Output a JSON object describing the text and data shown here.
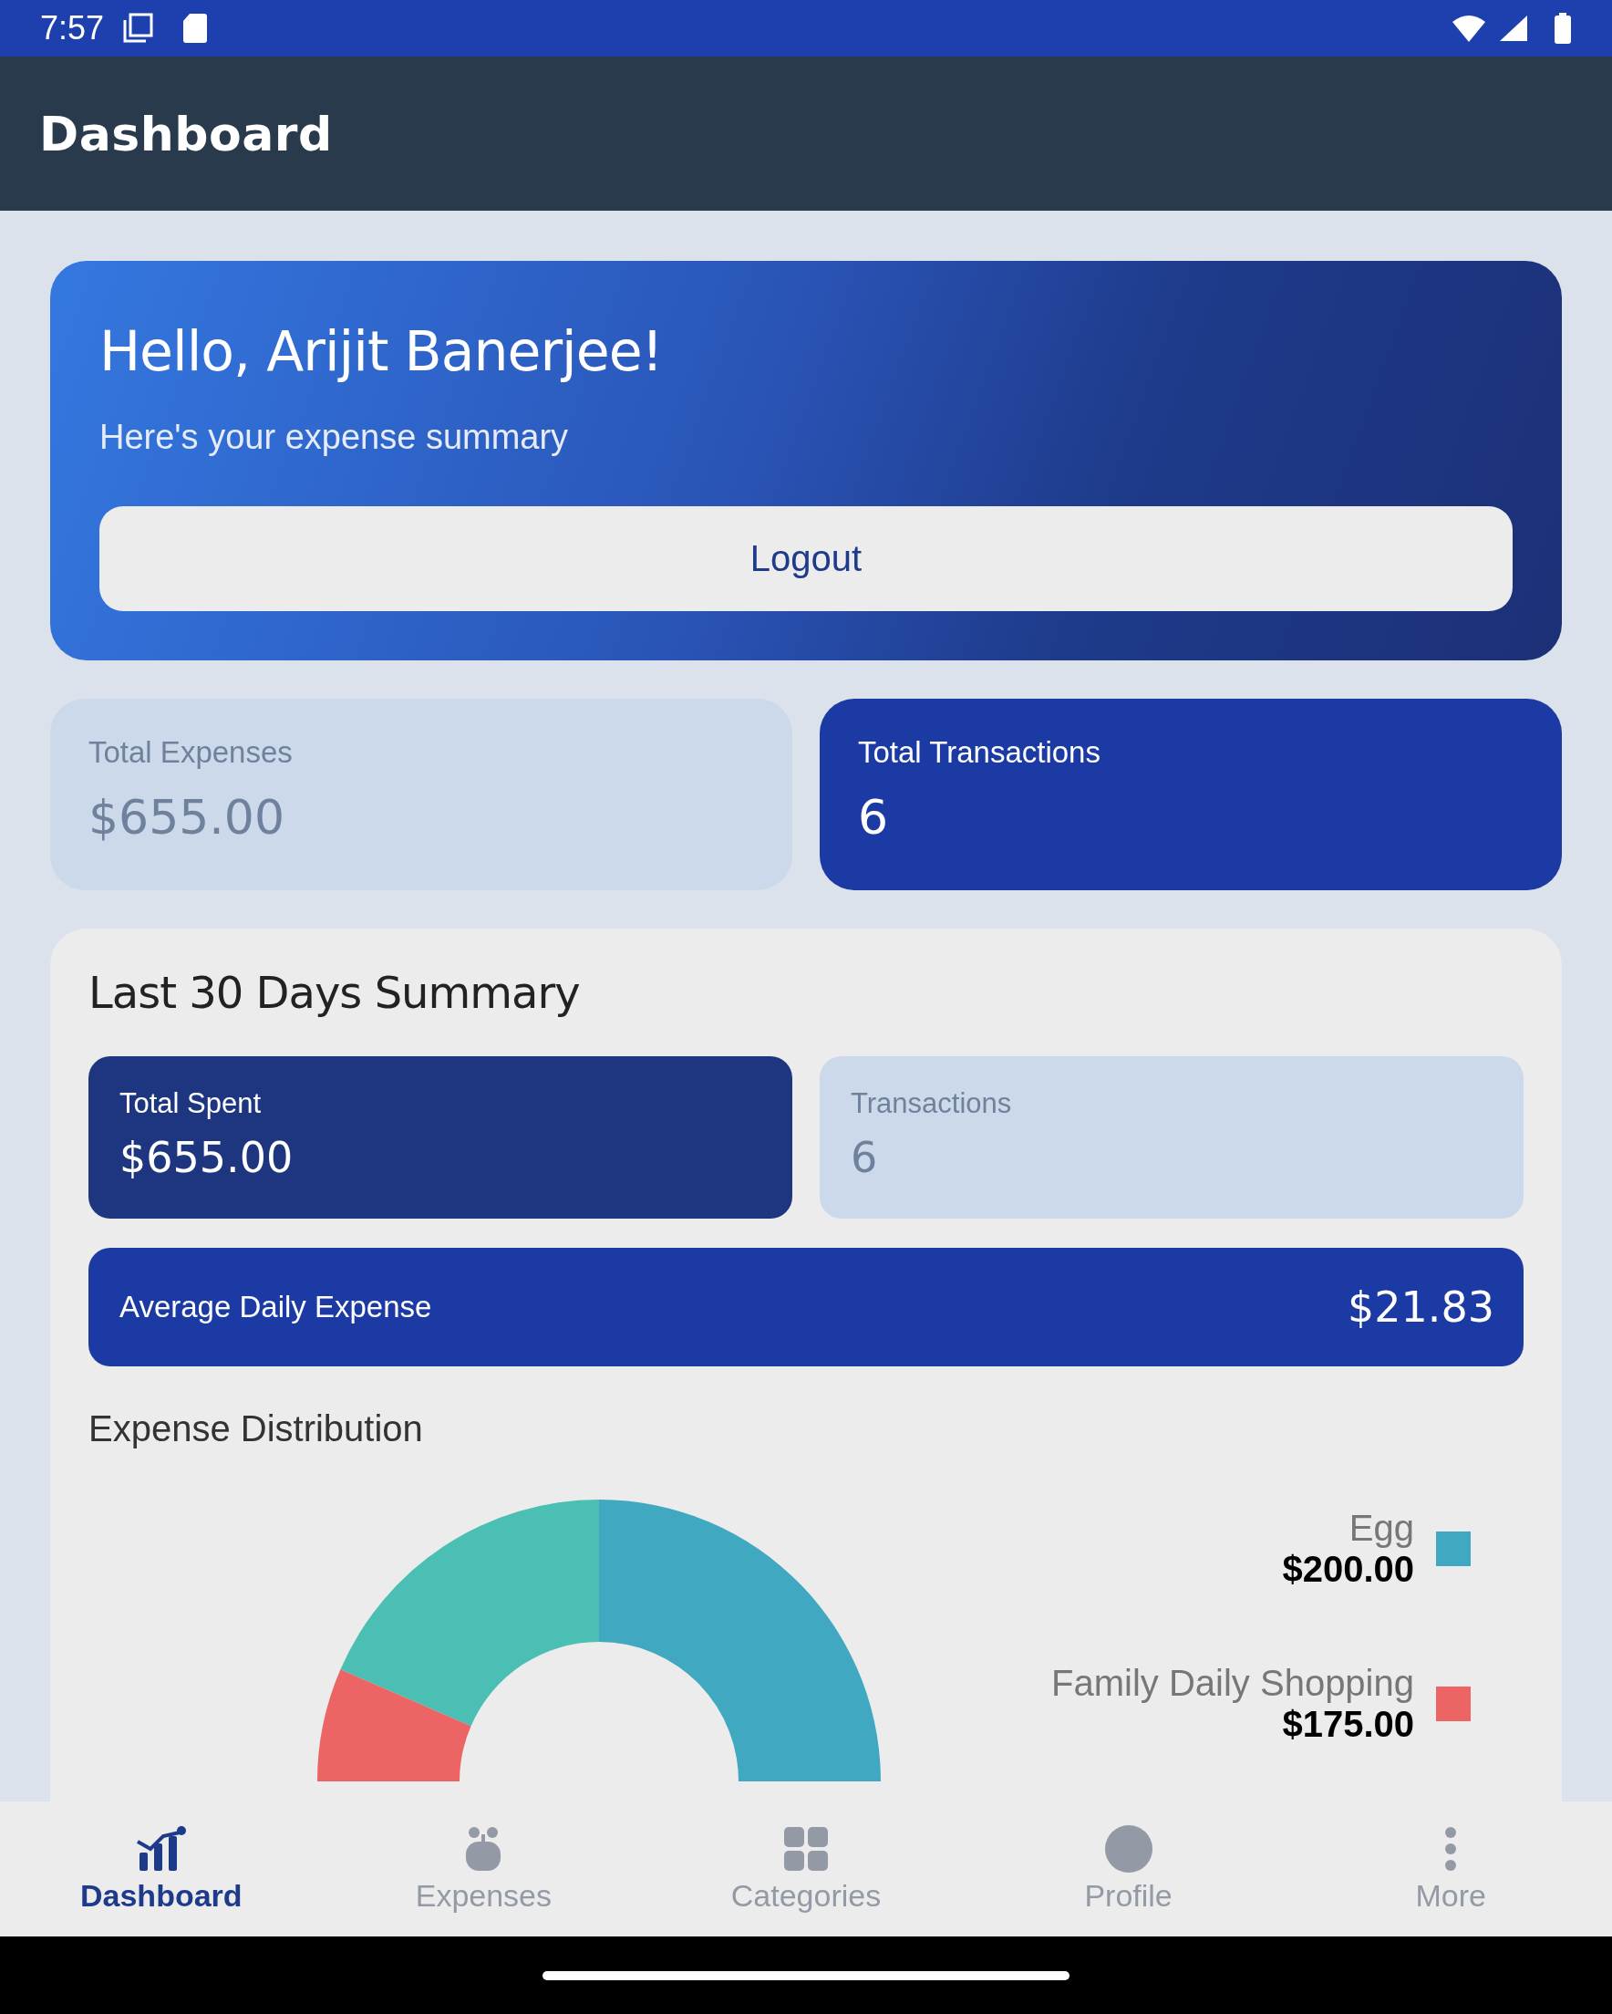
{
  "status_bar": {
    "time": "7:57"
  },
  "app_bar": {
    "title": "Dashboard"
  },
  "hero": {
    "greeting": "Hello, Arijit Banerjee!",
    "subtitle": "Here's your expense summary",
    "button": "Logout"
  },
  "stats": [
    {
      "label": "Total Expenses",
      "value": "$655.00",
      "kind": "muted"
    },
    {
      "label": "Total Transactions",
      "value": "6",
      "kind": "primary"
    }
  ],
  "summary": {
    "title": "Last 30 Days Summary",
    "cards": [
      {
        "label": "Total Spent",
        "value": "$655.00",
        "kind": "dark"
      },
      {
        "label": "Transactions",
        "value": "6",
        "kind": "muted"
      }
    ],
    "average": {
      "label": "Average Daily Expense",
      "value": "$21.83"
    },
    "distribution": {
      "title": "Expense Distribution",
      "legend": [
        {
          "label": "Egg",
          "amount": "$200.00",
          "color": "#41a8c2"
        },
        {
          "label": "Family Daily Shopping",
          "amount": "$175.00",
          "color": "#ec6464"
        }
      ]
    }
  },
  "nav": [
    {
      "label": "Dashboard",
      "selected": true
    },
    {
      "label": "Expenses",
      "selected": false
    },
    {
      "label": "Categories",
      "selected": false
    },
    {
      "label": "Profile",
      "selected": false
    },
    {
      "label": "More",
      "selected": false
    }
  ]
}
